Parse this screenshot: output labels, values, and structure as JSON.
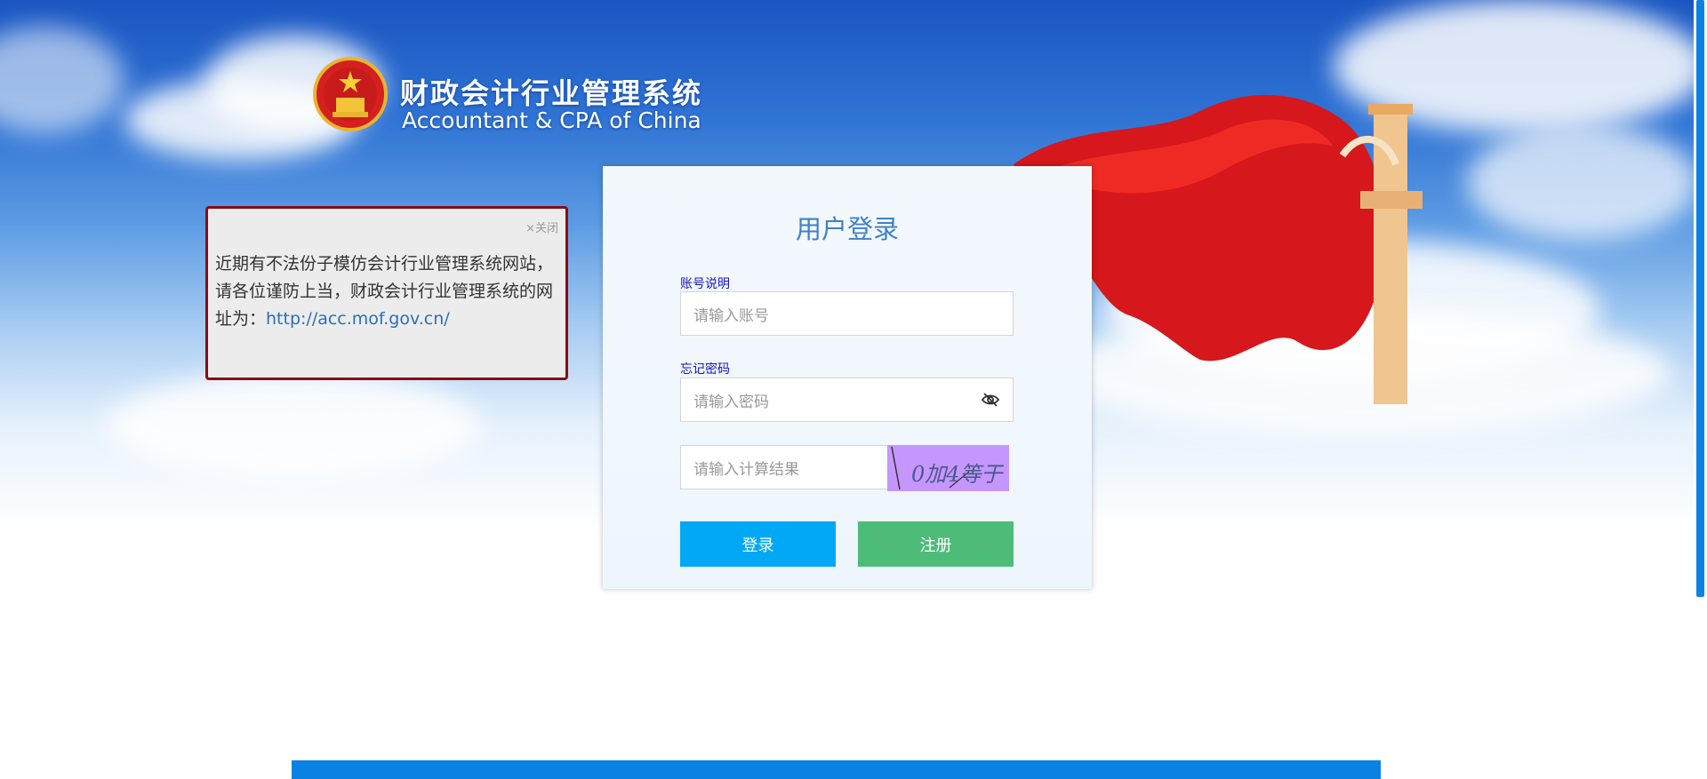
{
  "header": {
    "title": "财政会计行业管理系统",
    "subtitle": "Accountant & CPA of China",
    "emblem_icon": "national-emblem-icon"
  },
  "notice": {
    "close_label": "×关闭",
    "text": "近期有不法份子模仿会计行业管理系统网站，请各位谨防上当，财政会计行业管理系统的网址为：",
    "link": "http://acc.mof.gov.cn/"
  },
  "login": {
    "title": "用户登录",
    "account_help_link": "账号说明",
    "account_placeholder": "请输入账号",
    "forgot_password_link": "忘记密码",
    "password_placeholder": "请输入密码",
    "password_toggle_icon": "eye-slash-icon",
    "captcha_placeholder": "请输入计算结果",
    "captcha_text": "0加4等于",
    "login_button": "登录",
    "register_button": "注册"
  },
  "colors": {
    "accent_blue": "#00a8f5",
    "register_green": "#4dbc79",
    "notice_border": "#8b0b14",
    "title_blue": "#3f80c6",
    "footer_blue": "#0a82e4"
  }
}
